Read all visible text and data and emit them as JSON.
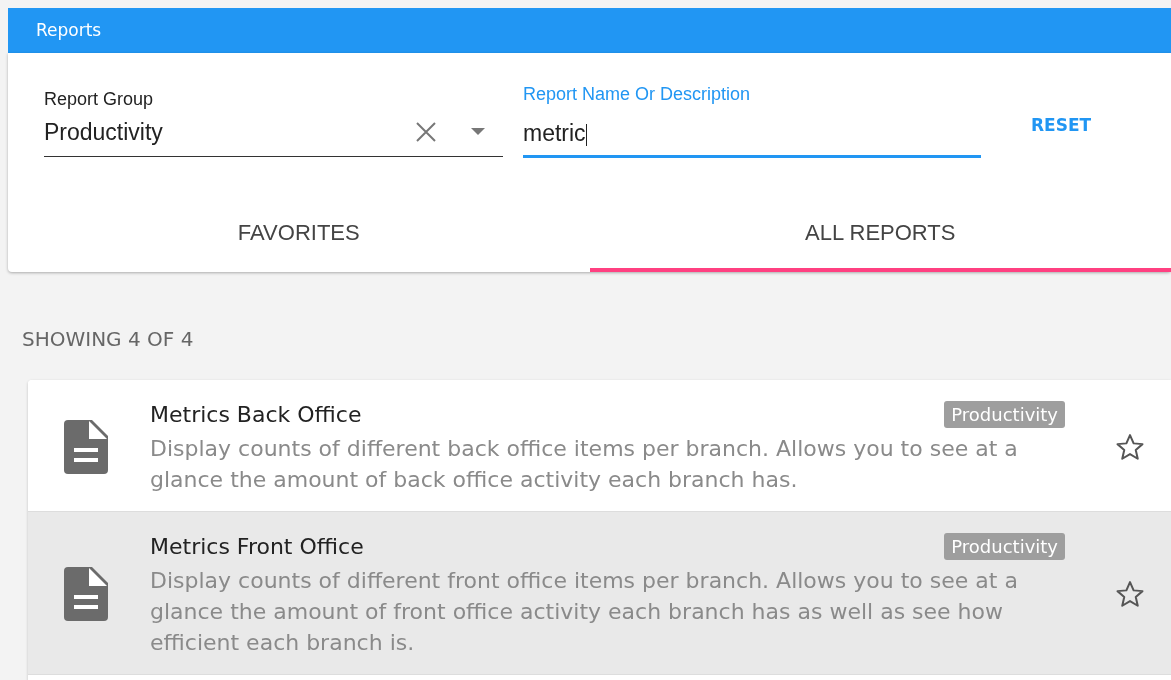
{
  "header": {
    "title": "Reports"
  },
  "filters": {
    "report_group": {
      "label": "Report Group",
      "value": "Productivity"
    },
    "search": {
      "label": "Report Name Or Description",
      "value": "metric",
      "focused": true
    },
    "reset": "RESET"
  },
  "tabs": [
    {
      "label": "FAVORITES",
      "selected": false
    },
    {
      "label": "ALL REPORTS",
      "selected": true
    }
  ],
  "count": "SHOWING 4 OF 4",
  "reports": [
    {
      "title": "Metrics Back Office",
      "tag": "Productivity",
      "description": "Display counts of different back office items per branch. Allows you to see at a glance the amount of back office activity each branch has.",
      "favorite": false,
      "hovered": false
    },
    {
      "title": "Metrics Front Office",
      "tag": "Productivity",
      "description": "Display counts of different front office items per branch. Allows you to see at a glance the amount of front office activity each branch has as well as see how efficient each branch is.",
      "favorite": false,
      "hovered": true
    }
  ]
}
